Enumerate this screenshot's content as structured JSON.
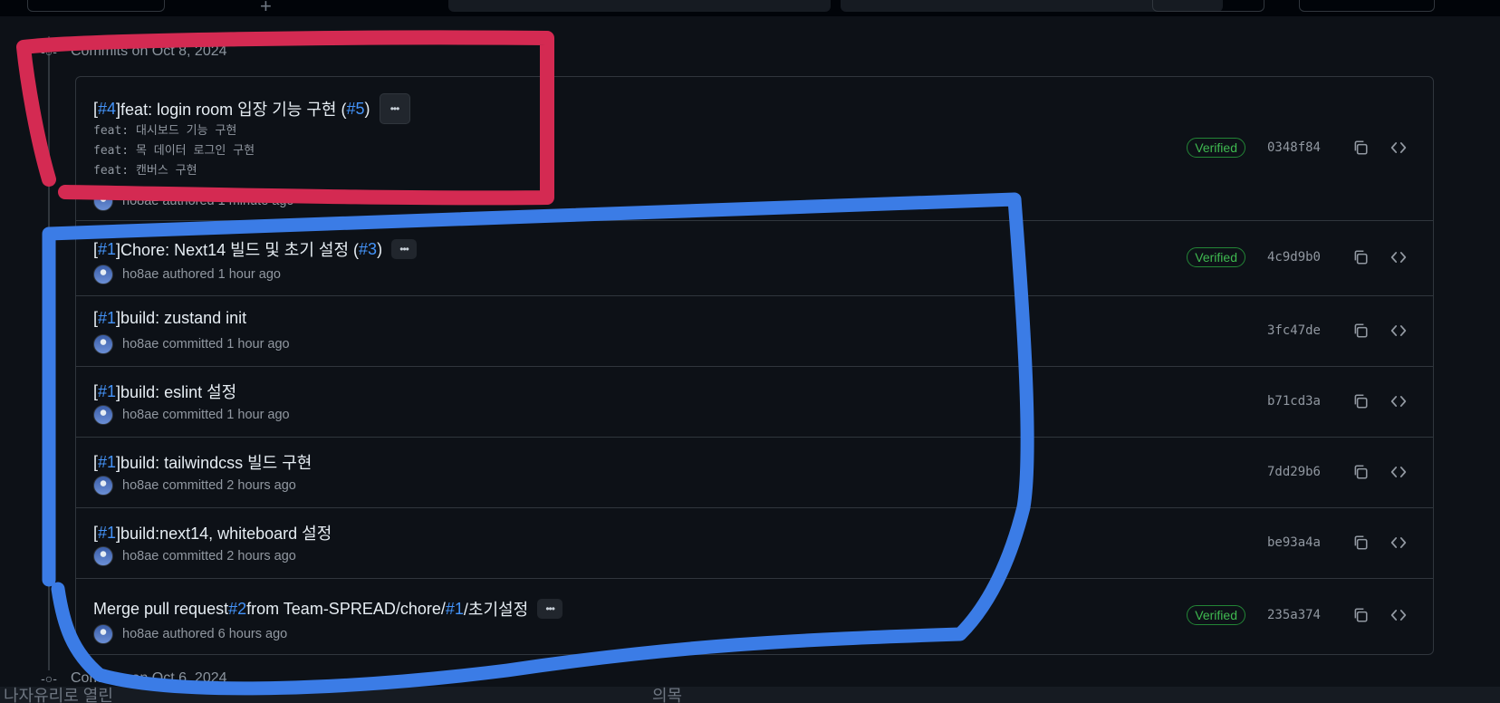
{
  "groups": {
    "oct8_header": "Commits on Oct 8, 2024",
    "oct6_header": "Commits on Oct 6, 2024"
  },
  "commits": [
    {
      "prefix": "[",
      "ref1": "#4",
      "text1": "]feat: login room 입장 기능 구현 (",
      "ref2": "#5",
      "text2": ")",
      "description": [
        "feat: 대시보드 기능 구현",
        "feat: 목 데이터 로그인 구현",
        "feat: 캔버스 구현"
      ],
      "author": "ho8ae",
      "action": "authored",
      "time": "1 minute ago",
      "verified": "Verified",
      "sha": "0348f84"
    },
    {
      "prefix": "[",
      "ref1": "#1",
      "text1": "]Chore: Next14 빌드 및 초기 설정 (",
      "ref2": "#3",
      "text2": ")",
      "author": "ho8ae",
      "action": "authored",
      "time": "1 hour ago",
      "verified": "Verified",
      "sha": "4c9d9b0"
    },
    {
      "prefix": "[",
      "ref1": "#1",
      "text1": "]build: zustand init",
      "author": "ho8ae",
      "action": "committed",
      "time": "1 hour ago",
      "sha": "3fc47de"
    },
    {
      "prefix": "[",
      "ref1": "#1",
      "text1": "]build: eslint 설정",
      "author": "ho8ae",
      "action": "committed",
      "time": "1 hour ago",
      "sha": "b71cd3a"
    },
    {
      "prefix": "[",
      "ref1": "#1",
      "text1": "]build: tailwindcss 빌드 구현",
      "author": "ho8ae",
      "action": "committed",
      "time": "2 hours ago",
      "sha": "7dd29b6"
    },
    {
      "prefix": "[",
      "ref1": "#1",
      "text1": "]build:next14, whiteboard 설정",
      "author": "ho8ae",
      "action": "committed",
      "time": "2 hours ago",
      "sha": "be93a4a"
    },
    {
      "prefix": "Merge pull request ",
      "ref1": "#2",
      "text1": " from Team-SPREAD/chore/",
      "ref2": "#1",
      "text2": "/초기설정",
      "author": "ho8ae",
      "action": "authored",
      "time": "6 hours ago",
      "verified": "Verified",
      "sha": "235a374"
    }
  ],
  "bottom": {
    "left_text": "나자유리로 열린",
    "mid_text": "의목"
  },
  "icons": {
    "commit_node": "git-commit-icon",
    "copy": "copy-icon",
    "browse": "code-icon",
    "ellipsis": "kebab-horizontal-icon"
  },
  "colors": {
    "link": "#4493f8",
    "verified": "#3fb950",
    "annotation_red": "#d42a52",
    "annotation_blue": "#3b7ce6"
  }
}
